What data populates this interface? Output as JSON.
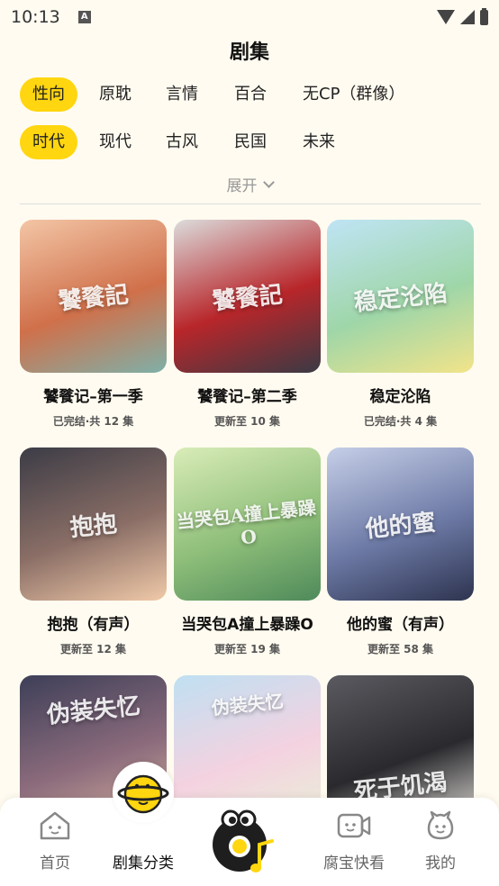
{
  "status": {
    "time": "10:13"
  },
  "title": "剧集",
  "filters": {
    "row1": [
      "性向",
      "原耽",
      "言情",
      "百合",
      "无CP（群像）"
    ],
    "row2": [
      "时代",
      "现代",
      "古风",
      "民国",
      "未来"
    ]
  },
  "expand_label": "展开",
  "cards": [
    {
      "title": "饕餮记–第一季",
      "sub": "已完结·共 12 集",
      "cover_text": "饕餮記",
      "c1": "#f3c6a6",
      "c2": "#d0704a",
      "c3": "#7fb0a8"
    },
    {
      "title": "饕餮记–第二季",
      "sub": "更新至 10 集",
      "cover_text": "饕餮記",
      "c1": "#dcdcdc",
      "c2": "#b8262a",
      "c3": "#3a3a44"
    },
    {
      "title": "稳定沦陷",
      "sub": "已完结·共 4 集",
      "cover_text": "稳定沦陷",
      "c1": "#bfe4f5",
      "c2": "#9fd6a8",
      "c3": "#f2e48a"
    },
    {
      "title": "抱抱（有声）",
      "sub": "更新至 12 集",
      "cover_text": "抱抱",
      "c1": "#3c3c46",
      "c2": "#8a6e66",
      "c3": "#f0c9a8"
    },
    {
      "title": "当哭包A撞上暴躁O",
      "sub": "更新至 19 集",
      "cover_text": "当哭包A撞上暴躁O",
      "c1": "#d9ecb8",
      "c2": "#8fbf7a",
      "c3": "#4f8a5a"
    },
    {
      "title": "他的蜜（有声）",
      "sub": "更新至 58 集",
      "cover_text": "他的蜜",
      "c1": "#c6cfe8",
      "c2": "#6d7aa6",
      "c3": "#2e3450"
    },
    {
      "title": "",
      "sub": "",
      "cover_text": "伪装失忆",
      "c1": "#3d3f58",
      "c2": "#8b6b7c",
      "c3": "#d9b4a0"
    },
    {
      "title": "",
      "sub": "",
      "cover_text": "伪装失忆",
      "c1": "#bfe0f2",
      "c2": "#f4d2e0",
      "c3": "#e9f1d8"
    },
    {
      "title": "",
      "sub": "",
      "cover_text": "死于饥渴",
      "c1": "#5a5a60",
      "c2": "#2a2a2e",
      "c3": "#e8e4de"
    }
  ],
  "nav": [
    {
      "label": "首页",
      "icon": "home-icon"
    },
    {
      "label": "剧集分类",
      "icon": "planet-mascot-icon"
    },
    {
      "label": "",
      "icon": "music-mascot-icon"
    },
    {
      "label": "腐宝快看",
      "icon": "video-icon"
    },
    {
      "label": "我的",
      "icon": "profile-mascot-icon"
    }
  ],
  "colors": {
    "accent": "#ffd60f",
    "background": "#fffbf0"
  }
}
